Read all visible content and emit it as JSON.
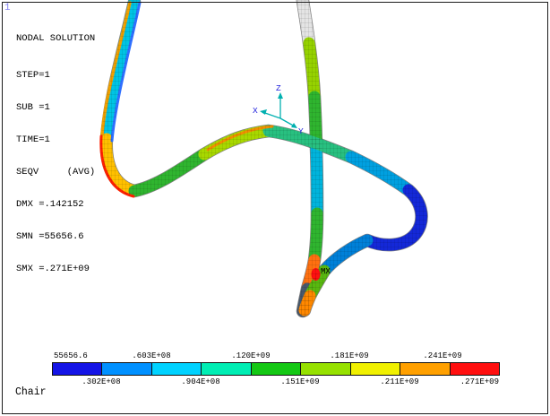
{
  "window": {
    "plot_number": "1",
    "caption": "Chair"
  },
  "solution_info": {
    "title": "NODAL SOLUTION",
    "lines": [
      "STEP=1",
      "SUB =1",
      "TIME=1",
      "SEQV     (AVG)",
      "DMX =.142152",
      "SMN =55656.6",
      "SMX =.271E+09"
    ]
  },
  "triad": {
    "x": "X",
    "y": "Y",
    "z": "Z"
  },
  "markers": {
    "max": "MX"
  },
  "legend": {
    "values": [
      "55656.6",
      ".302E+08",
      ".603E+08",
      ".904E+08",
      ".120E+09",
      ".151E+09",
      ".181E+09",
      ".211E+09",
      ".241E+09",
      ".271E+09"
    ],
    "colors": [
      "#1414e6",
      "#0090ff",
      "#00d2ff",
      "#00eeb4",
      "#14c814",
      "#96e100",
      "#f0f000",
      "#ffa000",
      "#ff0f0f"
    ]
  }
}
